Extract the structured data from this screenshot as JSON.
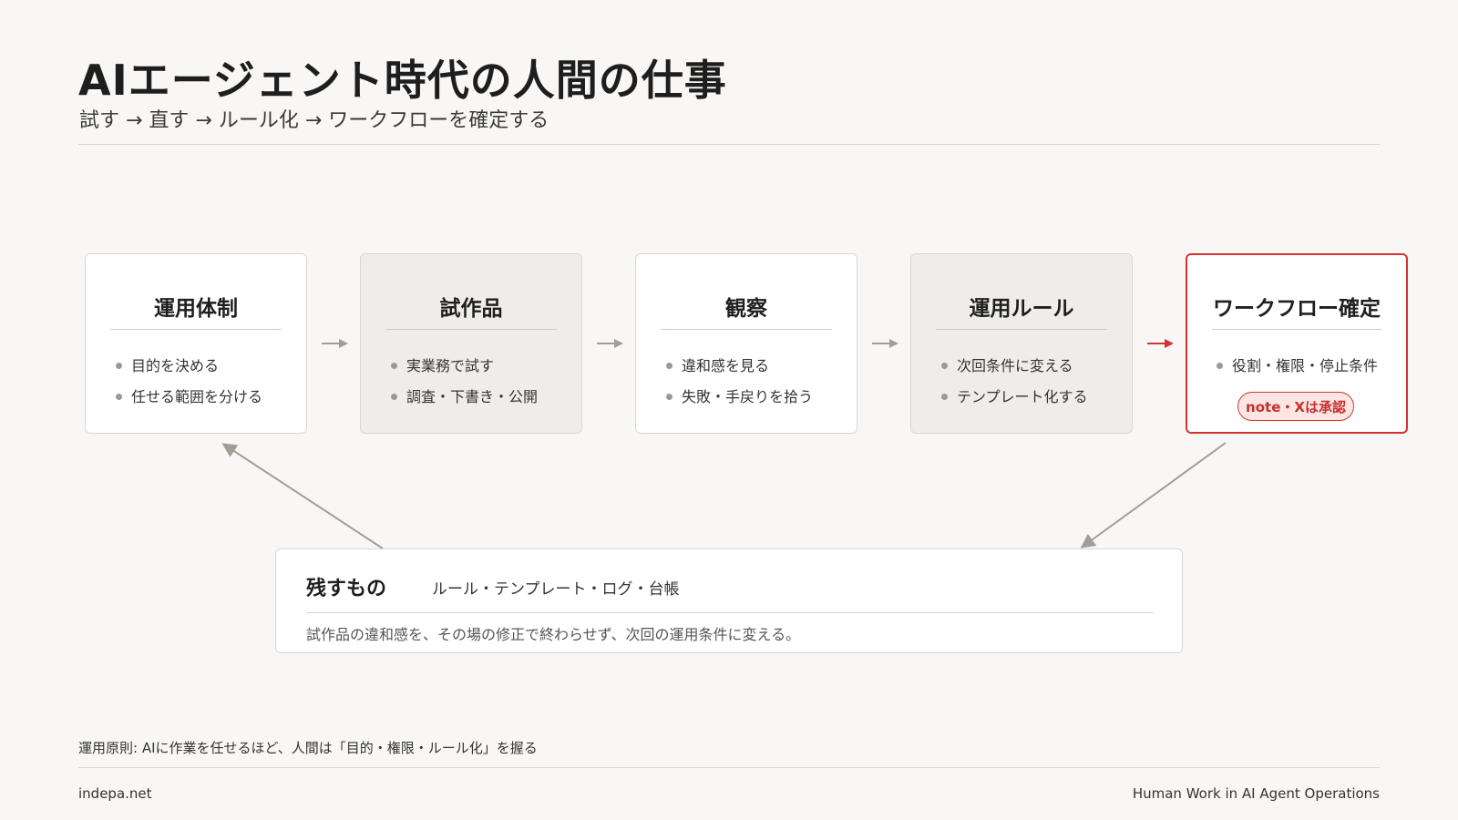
{
  "header": {
    "title": "AIエージェント時代の人間の仕事",
    "subtitle": "試す → 直す → ルール化 → ワークフローを確定する"
  },
  "flow": [
    {
      "title": "運用体制",
      "items": [
        "目的を決める",
        "任せる範囲を分ける"
      ]
    },
    {
      "title": "試作品",
      "items": [
        "実業務で試す",
        "調査・下書き・公開"
      ]
    },
    {
      "title": "観察",
      "items": [
        "違和感を見る",
        "失敗・手戻りを拾う"
      ]
    },
    {
      "title": "運用ルール",
      "items": [
        "次回条件に変える",
        "テンプレート化する"
      ]
    },
    {
      "title": "ワークフロー確定",
      "items": [
        "役割・権限・停止条件"
      ],
      "badge": "note・Xは承認"
    }
  ],
  "keep": {
    "title": "残すもの",
    "items": "ルール・テンプレート・ログ・台帳",
    "note": "試作品の違和感を、その場の修正で終わらせず、次回の運用条件に変える。"
  },
  "principle": "運用原則: AIに作業を任せるほど、人間は「目的・権限・ルール化」を握る",
  "footer": {
    "site": "indepa.net",
    "caption": "Human Work in AI Agent Operations"
  },
  "colors": {
    "accent": "#d6332f",
    "arrow": "#a39d95",
    "shaded": "#efede9"
  }
}
